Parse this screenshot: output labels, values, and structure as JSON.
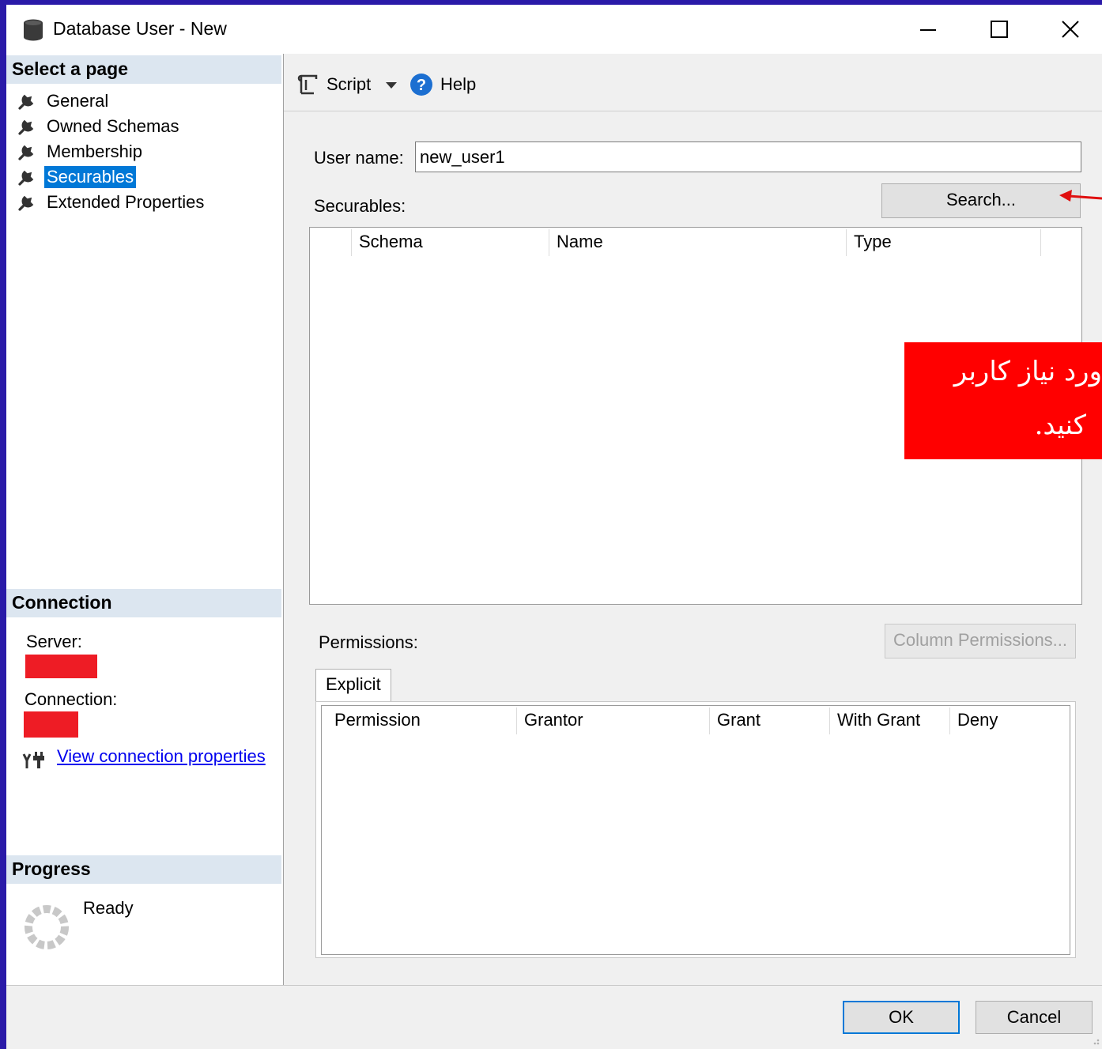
{
  "window": {
    "title": "Database User - New"
  },
  "sidebar": {
    "select_page_header": "Select a page",
    "pages": [
      {
        "label": "General"
      },
      {
        "label": "Owned Schemas"
      },
      {
        "label": "Membership"
      },
      {
        "label": "Securables",
        "selected": true
      },
      {
        "label": "Extended Properties"
      }
    ],
    "connection_header": "Connection",
    "server_label": "Server:",
    "connection_label": "Connection:",
    "view_connection_link": "View connection properties",
    "progress_header": "Progress",
    "progress_status": "Ready"
  },
  "toolbar": {
    "script_label": "Script",
    "help_label": "Help"
  },
  "form": {
    "user_name_label": "User name:",
    "user_name_value": "new_user1",
    "securables_label": "Securables:",
    "search_button": "Search...",
    "securables_columns": [
      "Schema",
      "Name",
      "Type"
    ],
    "permissions_label": "Permissions:",
    "column_permissions_button": "Column Permissions...",
    "explicit_tab": "Explicit",
    "permissions_columns": [
      "Permission",
      "Grantor",
      "Grant",
      "With Grant",
      "Deny"
    ]
  },
  "footer": {
    "ok_button": "OK",
    "cancel_button": "Cancel"
  },
  "annotation": {
    "callout_line1": "ورد نیاز کاربر",
    "callout_line2": "کنید."
  },
  "colors": {
    "accent": "#0078d7",
    "redaction": "#ee1c25",
    "callout": "#ff0000",
    "backdrop": "#2a1aa8"
  }
}
